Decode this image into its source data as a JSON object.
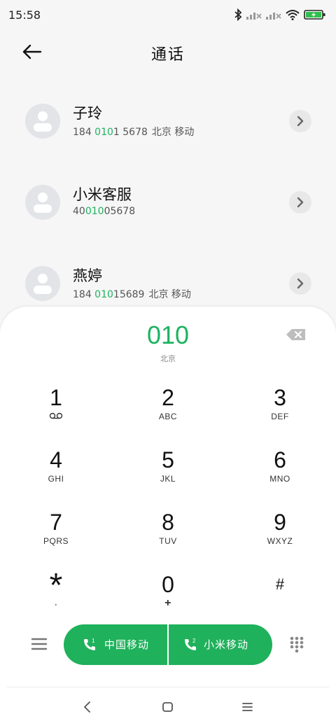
{
  "status_bar": {
    "time": "15:58",
    "icons": [
      "bluetooth-icon",
      "signal-1-icon",
      "signal-2-icon",
      "wifi-icon",
      "battery-charging-icon"
    ]
  },
  "header": {
    "title": "通话",
    "back_icon": "arrow-left-icon"
  },
  "contacts": [
    {
      "name": "子玲",
      "number_pre": "184 ",
      "number_hl": "010",
      "number_post": "1 5678",
      "location": "北京 移动"
    },
    {
      "name": "小米客服",
      "number_pre": "40",
      "number_hl": "010",
      "number_post": "05678",
      "location": ""
    },
    {
      "name": "燕婷",
      "number_pre": "184 ",
      "number_hl": "010",
      "number_post": "15689",
      "location": "北京 移动"
    }
  ],
  "dialer": {
    "dialed": "010",
    "region": "北京",
    "keys": [
      {
        "digit": "1",
        "letters": ""
      },
      {
        "digit": "2",
        "letters": "ABC"
      },
      {
        "digit": "3",
        "letters": "DEF"
      },
      {
        "digit": "4",
        "letters": "GHI"
      },
      {
        "digit": "5",
        "letters": "JKL"
      },
      {
        "digit": "6",
        "letters": "MNO"
      },
      {
        "digit": "7",
        "letters": "PQRS"
      },
      {
        "digit": "8",
        "letters": "TUV"
      },
      {
        "digit": "9",
        "letters": "WXYZ"
      },
      {
        "digit": "*",
        "letters": ","
      },
      {
        "digit": "0",
        "letters": "+"
      },
      {
        "digit": "#",
        "letters": ""
      }
    ]
  },
  "call_buttons": [
    {
      "sim": "1",
      "label": "中国移动"
    },
    {
      "sim": "2",
      "label": "小米移动"
    }
  ],
  "colors": {
    "accent": "#1eb35f",
    "call_bg": "#1fb15b",
    "panel_bg": "#ffffff",
    "page_bg": "#f6f6f6"
  }
}
